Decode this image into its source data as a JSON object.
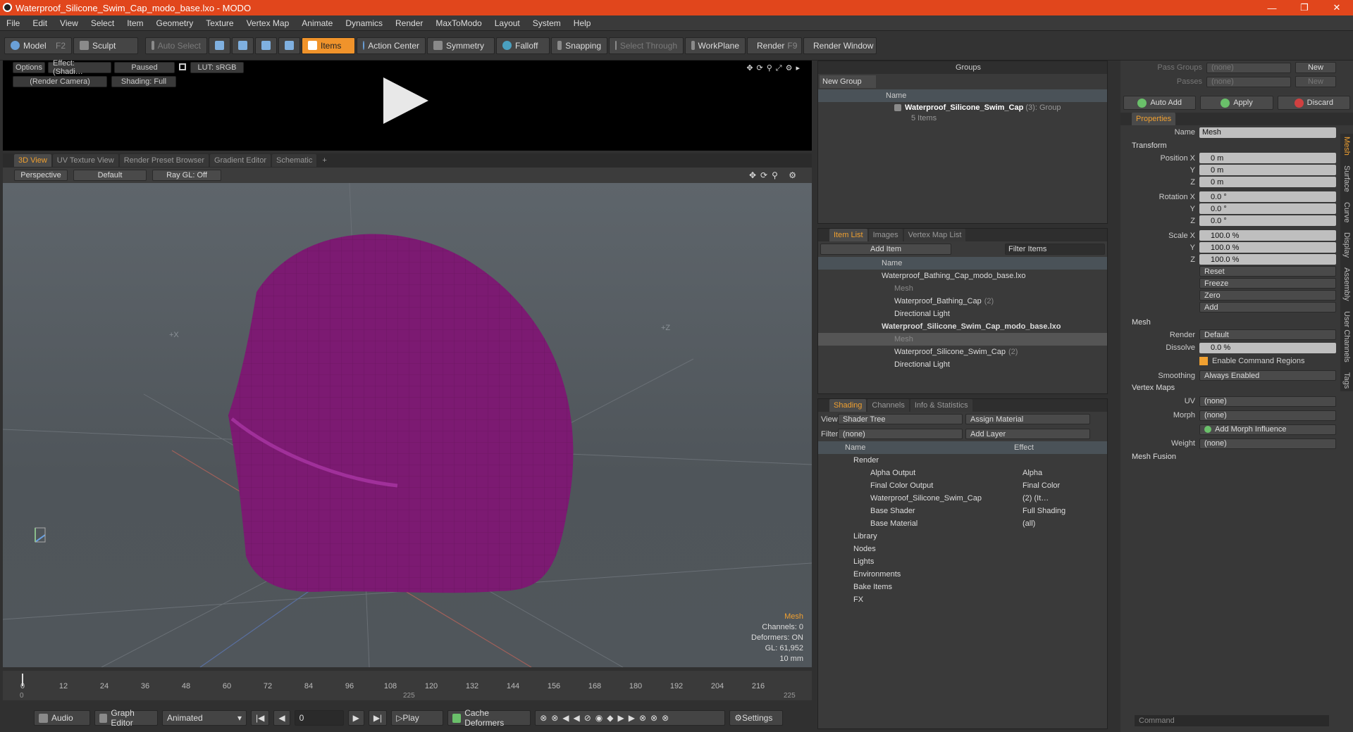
{
  "window": {
    "title": "Waterproof_Silicone_Swim_Cap_modo_base.lxo - MODO",
    "minimize": "—",
    "maximize": "❐",
    "close": "✕"
  },
  "menu": [
    "File",
    "Edit",
    "View",
    "Select",
    "Item",
    "Geometry",
    "Texture",
    "Vertex Map",
    "Animate",
    "Dynamics",
    "Render",
    "MaxToModo",
    "Layout",
    "System",
    "Help"
  ],
  "toolbar": {
    "model": "Model",
    "model_key": "F2",
    "sculpt": "Sculpt",
    "auto_select": "Auto Select",
    "items": "Items",
    "action_center": "Action Center",
    "symmetry": "Symmetry",
    "falloff": "Falloff",
    "snapping": "Snapping",
    "select_through": "Select Through",
    "workplane": "WorkPlane",
    "render": "Render",
    "render_key": "F9",
    "render_window": "Render Window"
  },
  "preview": {
    "options": "Options",
    "effect": "Effect: (Shadi…",
    "paused": "Paused",
    "lut": "LUT: sRGB",
    "camera": "(Render Camera)",
    "shading": "Shading: Full"
  },
  "view_tabs": [
    "3D View",
    "UV Texture View",
    "Render Preset Browser",
    "Gradient Editor",
    "Schematic"
  ],
  "viewport": {
    "perspective": "Perspective",
    "default": "Default",
    "raygl": "Ray GL: Off",
    "hud": {
      "item": "Mesh",
      "channels": "Channels: 0",
      "deformers": "Deformers: ON",
      "gl": "GL: 61,952",
      "size": "10 mm"
    },
    "axis_x": "+X",
    "axis_z": "+Z"
  },
  "timeline": {
    "ticks": [
      "0",
      "12",
      "24",
      "36",
      "48",
      "60",
      "72",
      "84",
      "96",
      "108",
      "120",
      "132",
      "144",
      "156",
      "168",
      "180",
      "192",
      "204",
      "216"
    ],
    "start": "0",
    "end": "225",
    "mid": "225"
  },
  "bottom": {
    "audio": "Audio",
    "graph_editor": "Graph Editor",
    "animated": "Animated",
    "frame": "0",
    "play": "Play",
    "cache": "Cache Deformers",
    "settings": "Settings"
  },
  "groups": {
    "title": "Groups",
    "new_group": "New Group",
    "col_name": "Name",
    "item": "Waterproof_Silicone_Swim_Cap",
    "item_count": "(3)",
    "item_type": ": Group",
    "item_sub": "5 Items"
  },
  "itemlist": {
    "tabs": [
      "Item List",
      "Images",
      "Vertex Map List"
    ],
    "add_item": "Add Item",
    "filter": "Filter Items",
    "col_name": "Name",
    "rows": [
      {
        "label": "Waterproof_Bathing_Cap_modo_base.lxo",
        "extra": "",
        "indent": 0,
        "bold": false,
        "dim": false
      },
      {
        "label": "Mesh",
        "extra": "",
        "indent": 1,
        "bold": false,
        "dim": true
      },
      {
        "label": "Waterproof_Bathing_Cap",
        "extra": "(2)",
        "indent": 1,
        "bold": false,
        "dim": false
      },
      {
        "label": "Directional Light",
        "extra": "",
        "indent": 1,
        "bold": false,
        "dim": false
      },
      {
        "label": "Waterproof_Silicone_Swim_Cap_modo_base.lxo",
        "extra": "",
        "indent": 0,
        "bold": true,
        "dim": false
      },
      {
        "label": "Mesh",
        "extra": "",
        "indent": 1,
        "bold": false,
        "dim": true
      },
      {
        "label": "Waterproof_Silicone_Swim_Cap",
        "extra": "(2)",
        "indent": 1,
        "bold": false,
        "dim": false
      },
      {
        "label": "Directional Light",
        "extra": "",
        "indent": 1,
        "bold": false,
        "dim": false
      }
    ]
  },
  "shading": {
    "tabs": [
      "Shading",
      "Channels",
      "Info & Statistics"
    ],
    "view_label": "View",
    "view_value": "Shader Tree",
    "assign": "Assign Material",
    "filter_label": "Filter",
    "filter_value": "(none)",
    "add_layer": "Add Layer",
    "col_name": "Name",
    "col_effect": "Effect",
    "rows": [
      {
        "name": "Render",
        "effect": ""
      },
      {
        "name": "Alpha Output",
        "effect": "Alpha"
      },
      {
        "name": "Final Color Output",
        "effect": "Final Color"
      },
      {
        "name": "Waterproof_Silicone_Swim_Cap",
        "effect": "(2) (It…"
      },
      {
        "name": "Base Shader",
        "effect": "Full Shading"
      },
      {
        "name": "Base Material",
        "effect": "(all)"
      },
      {
        "name": "Library",
        "effect": ""
      },
      {
        "name": "Nodes",
        "effect": ""
      },
      {
        "name": "Lights",
        "effect": ""
      },
      {
        "name": "Environments",
        "effect": ""
      },
      {
        "name": "Bake Items",
        "effect": ""
      },
      {
        "name": "FX",
        "effect": ""
      }
    ]
  },
  "props": {
    "pass_groups": "Pass Groups",
    "passes": "Passes",
    "none": "(none)",
    "new": "New",
    "auto_add": "Auto Add",
    "apply": "Apply",
    "discard": "Discard",
    "tab": "Properties",
    "name_label": "Name",
    "name_value": "Mesh",
    "transform": "Transform",
    "pos_label": "Position X",
    "rot_label": "Rotation X",
    "scale_label": "Scale X",
    "y": "Y",
    "z": "Z",
    "pos": [
      "0 m",
      "0 m",
      "0 m"
    ],
    "rot": [
      "0.0 °",
      "0.0 °",
      "0.0 °"
    ],
    "scale": [
      "100.0 %",
      "100.0 %",
      "100.0 %"
    ],
    "reset": "Reset",
    "freeze": "Freeze",
    "zero": "Zero",
    "add": "Add",
    "mesh": "Mesh",
    "render_label": "Render",
    "render_value": "Default",
    "dissolve_label": "Dissolve",
    "dissolve_value": "0.0 %",
    "enable_regions": "Enable Command Regions",
    "smoothing_label": "Smoothing",
    "smoothing_value": "Always Enabled",
    "vertex_maps": "Vertex Maps",
    "uv_label": "UV",
    "morph_label": "Morph",
    "add_morph": "Add Morph Influence",
    "weight_label": "Weight",
    "mesh_fusion": "Mesh Fusion",
    "side_tabs": [
      "Mesh",
      "Surface",
      "Curve",
      "Display",
      "Assembly",
      "User Channels",
      "Tags"
    ],
    "command": "Command"
  }
}
